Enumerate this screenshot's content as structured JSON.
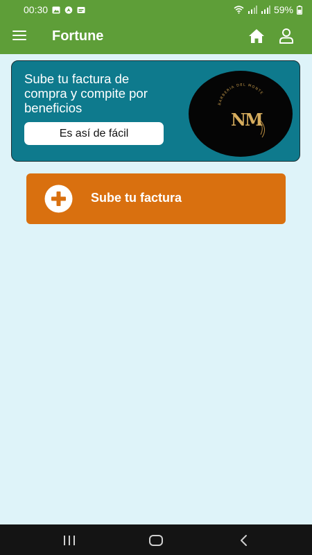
{
  "status_bar": {
    "time": "00:30",
    "battery": "59%",
    "icons": [
      "gallery-icon",
      "navigation-icon",
      "notification-icon",
      "wifi-icon",
      "signal-icon",
      "signal-icon",
      "battery-icon"
    ]
  },
  "app_bar": {
    "title": "Fortune",
    "menu_icon": "menu-icon",
    "home_icon": "home-icon",
    "profile_icon": "user-icon"
  },
  "promo": {
    "text": "Sube tu factura de compra y compite por beneficios",
    "button_label": "Es así de fácil",
    "logo": {
      "initials": "NM",
      "arc_text": "BARBERIA DEL MONTE"
    }
  },
  "upload": {
    "label": "Sube tu factura",
    "icon": "plus-circle-icon"
  },
  "colors": {
    "header": "#5e9e38",
    "background": "#def3f9",
    "card": "#0e7a8d",
    "upload_button": "#d9700f",
    "logo_gold": "#c69a4a"
  },
  "nav_bar": {
    "icons": [
      "recents-icon",
      "home-circle-icon",
      "back-icon"
    ]
  }
}
